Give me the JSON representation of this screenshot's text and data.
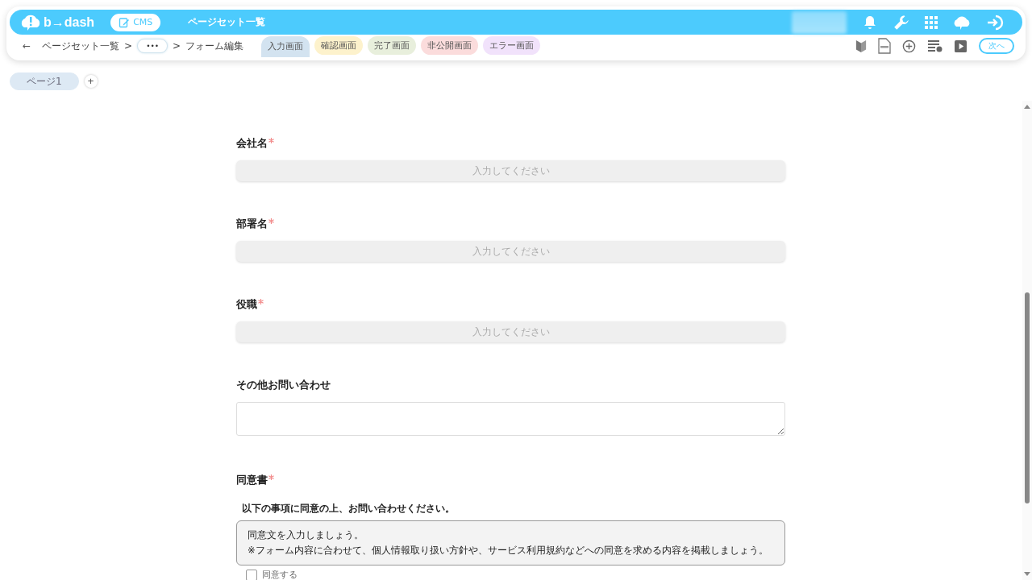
{
  "header": {
    "logo": "b→dash",
    "app_button": "CMS",
    "title": "ページセット一覧"
  },
  "breadcrumb": {
    "back": "←",
    "items": [
      {
        "kind": "link",
        "label": "ページセット一覧"
      },
      {
        "kind": "sep",
        "label": ">"
      },
      {
        "kind": "more",
        "label": "•••"
      },
      {
        "kind": "sep",
        "label": ">"
      },
      {
        "kind": "text",
        "label": "フォーム編集"
      }
    ]
  },
  "screen_tabs": [
    {
      "label": "入力画面",
      "selected": true,
      "color": "#d3e3f0"
    },
    {
      "label": "確認画面",
      "selected": false,
      "color": "#fdf2cc"
    },
    {
      "label": "完了画面",
      "selected": false,
      "color": "#e8efdc"
    },
    {
      "label": "非公開画面",
      "selected": false,
      "color": "#fbdcdc"
    },
    {
      "label": "エラー画面",
      "selected": false,
      "color": "#f1e2fb"
    }
  ],
  "next_button": "次へ",
  "pages": [
    {
      "label": "ページ1",
      "selected": true
    }
  ],
  "add_page": "+",
  "fields": [
    {
      "kind": "text",
      "label": "会社名",
      "required": true,
      "placeholder": "入力してください"
    },
    {
      "kind": "text",
      "label": "部署名",
      "required": true,
      "placeholder": "入力してください"
    },
    {
      "kind": "text",
      "label": "役職",
      "required": true,
      "placeholder": "入力してください"
    },
    {
      "kind": "textarea",
      "label": "その他お問い合わせ",
      "required": false
    },
    {
      "kind": "consent",
      "label": "同意書",
      "required": true,
      "heading": "以下の事項に同意の上、お問い合わせください。",
      "lines": [
        "同意文を入力しましょう。",
        "※フォーム内容に合わせて、個人情報取り扱い方針や、サービス利用規約などへの同意を求める内容を掲載しましょう。"
      ],
      "checkbox_label": "同意する",
      "checked": false
    }
  ]
}
